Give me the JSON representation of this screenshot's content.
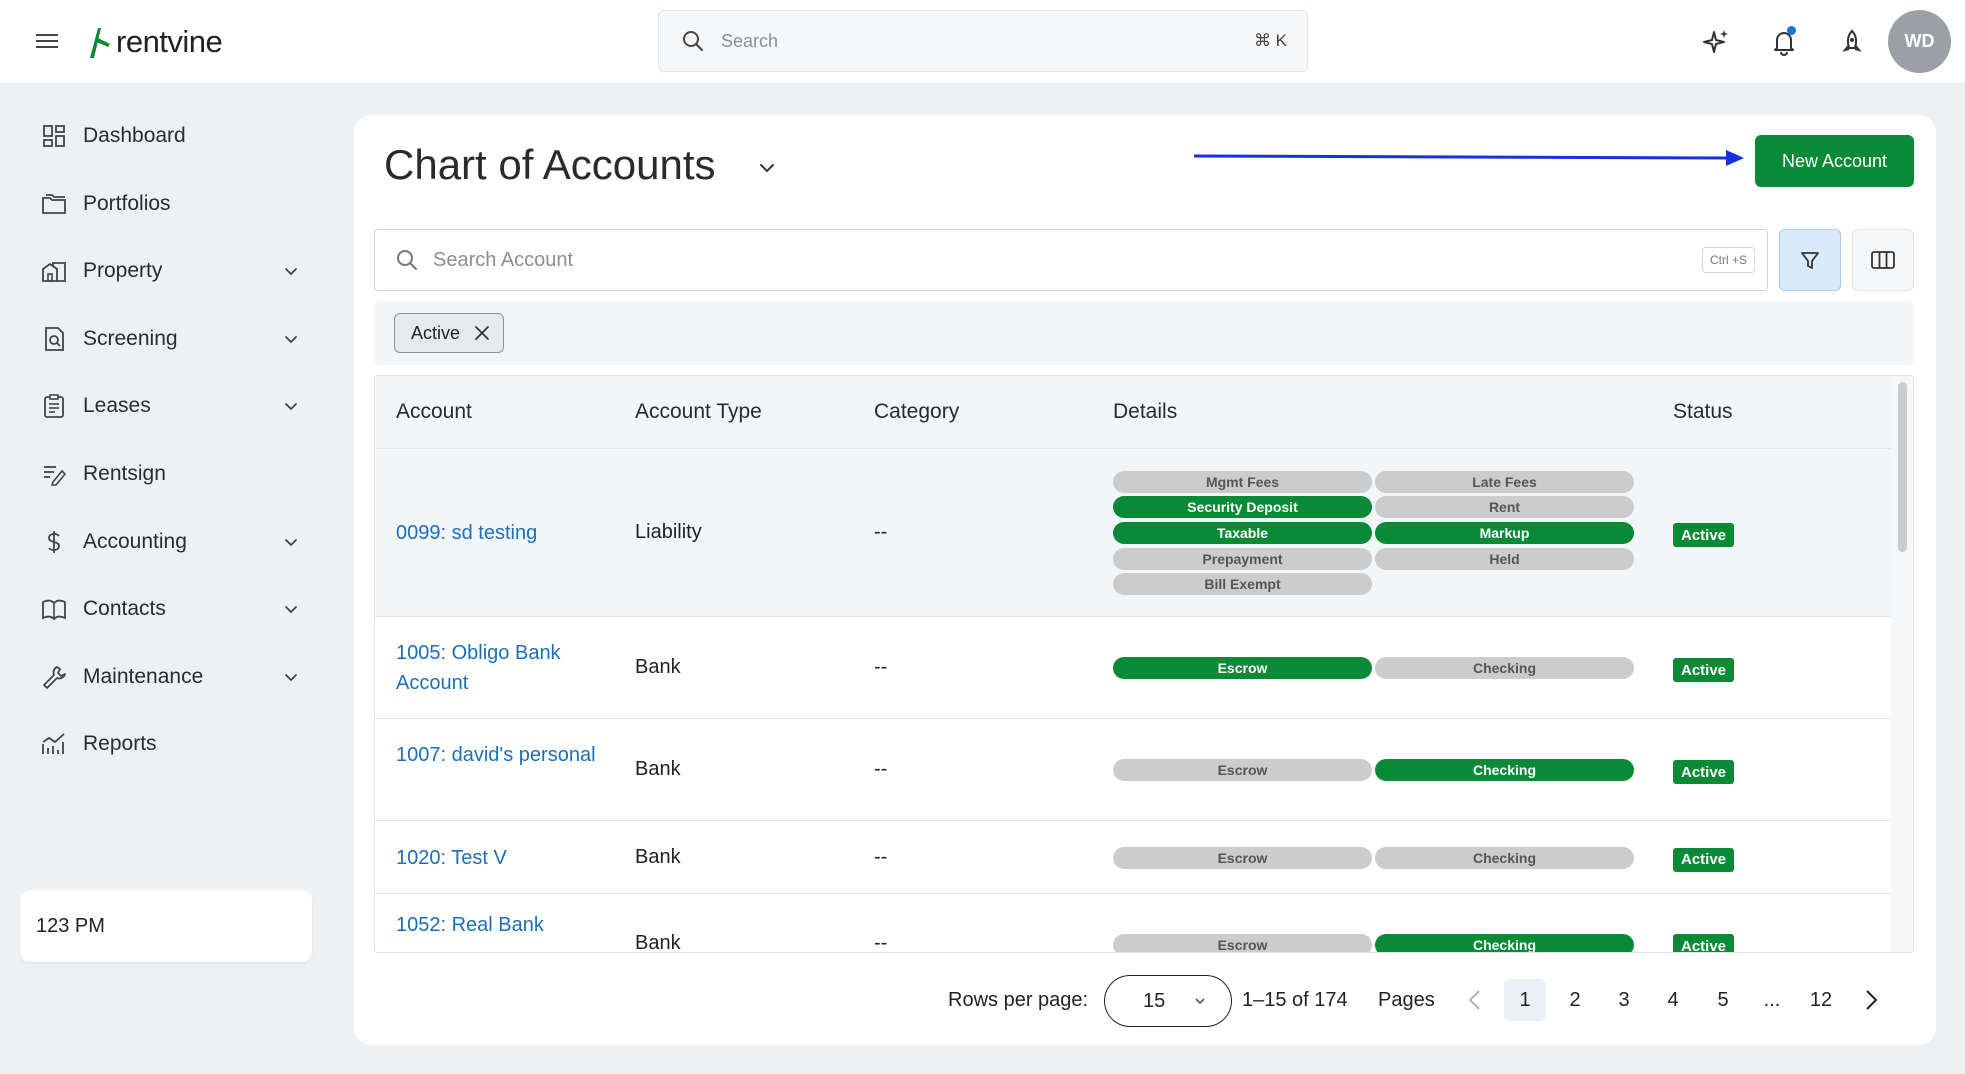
{
  "brand": {
    "name": "rentvine"
  },
  "header": {
    "search_placeholder": "Search",
    "search_shortcut": "⌘ K",
    "avatar_initials": "WD"
  },
  "sidebar": {
    "items": [
      {
        "label": "Dashboard",
        "icon": "dashboard-icon",
        "expandable": false
      },
      {
        "label": "Portfolios",
        "icon": "folder-icon",
        "expandable": false
      },
      {
        "label": "Property",
        "icon": "building-icon",
        "expandable": true
      },
      {
        "label": "Screening",
        "icon": "screening-icon",
        "expandable": true
      },
      {
        "label": "Leases",
        "icon": "clipboard-icon",
        "expandable": true
      },
      {
        "label": "Rentsign",
        "icon": "signature-icon",
        "expandable": false
      },
      {
        "label": "Accounting",
        "icon": "dollar-icon",
        "expandable": true
      },
      {
        "label": "Contacts",
        "icon": "book-icon",
        "expandable": true
      },
      {
        "label": "Maintenance",
        "icon": "wrench-icon",
        "expandable": true
      },
      {
        "label": "Reports",
        "icon": "chart-icon",
        "expandable": false
      }
    ],
    "footer_text": "123 PM"
  },
  "page": {
    "title": "Chart of Accounts",
    "new_button_label": "New Account",
    "search_placeholder": "Search Account",
    "search_shortcut": "Ctrl +S",
    "active_filter_chip": "Active"
  },
  "table": {
    "columns": [
      "Account",
      "Account Type",
      "Category",
      "Details",
      "Status"
    ],
    "rows": [
      {
        "account": "0099: sd testing",
        "type": "Liability",
        "category": "--",
        "details": [
          {
            "label": "Mgmt Fees",
            "on": false
          },
          {
            "label": "Late Fees",
            "on": false
          },
          {
            "label": "Security Deposit",
            "on": true
          },
          {
            "label": "Rent",
            "on": false
          },
          {
            "label": "Taxable",
            "on": true
          },
          {
            "label": "Markup",
            "on": true
          },
          {
            "label": "Prepayment",
            "on": false
          },
          {
            "label": "Held",
            "on": false
          },
          {
            "label": "Bill Exempt",
            "on": false
          }
        ],
        "status": "Active"
      },
      {
        "account": "1005: Obligo Bank Account",
        "type": "Bank",
        "category": "--",
        "details": [
          {
            "label": "Escrow",
            "on": true
          },
          {
            "label": "Checking",
            "on": false
          }
        ],
        "status": "Active"
      },
      {
        "account": "1007: david's personal",
        "type": "Bank",
        "category": "--",
        "details": [
          {
            "label": "Escrow",
            "on": false
          },
          {
            "label": "Checking",
            "on": true
          }
        ],
        "status": "Active"
      },
      {
        "account": "1020: Test V",
        "type": "Bank",
        "category": "--",
        "details": [
          {
            "label": "Escrow",
            "on": false
          },
          {
            "label": "Checking",
            "on": false
          }
        ],
        "status": "Active"
      },
      {
        "account": "1052: Real Bank",
        "type": "Bank",
        "category": "--",
        "details": [
          {
            "label": "Escrow",
            "on": false
          },
          {
            "label": "Checking",
            "on": true
          }
        ],
        "status": "Active"
      }
    ]
  },
  "pagination": {
    "rows_per_page_label": "Rows per page:",
    "rows_per_page": "15",
    "range_text": "1–15 of 174",
    "pages_label": "Pages",
    "pages": [
      "1",
      "2",
      "3",
      "4",
      "5",
      "...",
      "12"
    ],
    "current_page": "1"
  },
  "colors": {
    "brand_green": "#0a8a36",
    "link_blue": "#1e6fb8",
    "annotation_arrow": "#1a2fe0"
  }
}
